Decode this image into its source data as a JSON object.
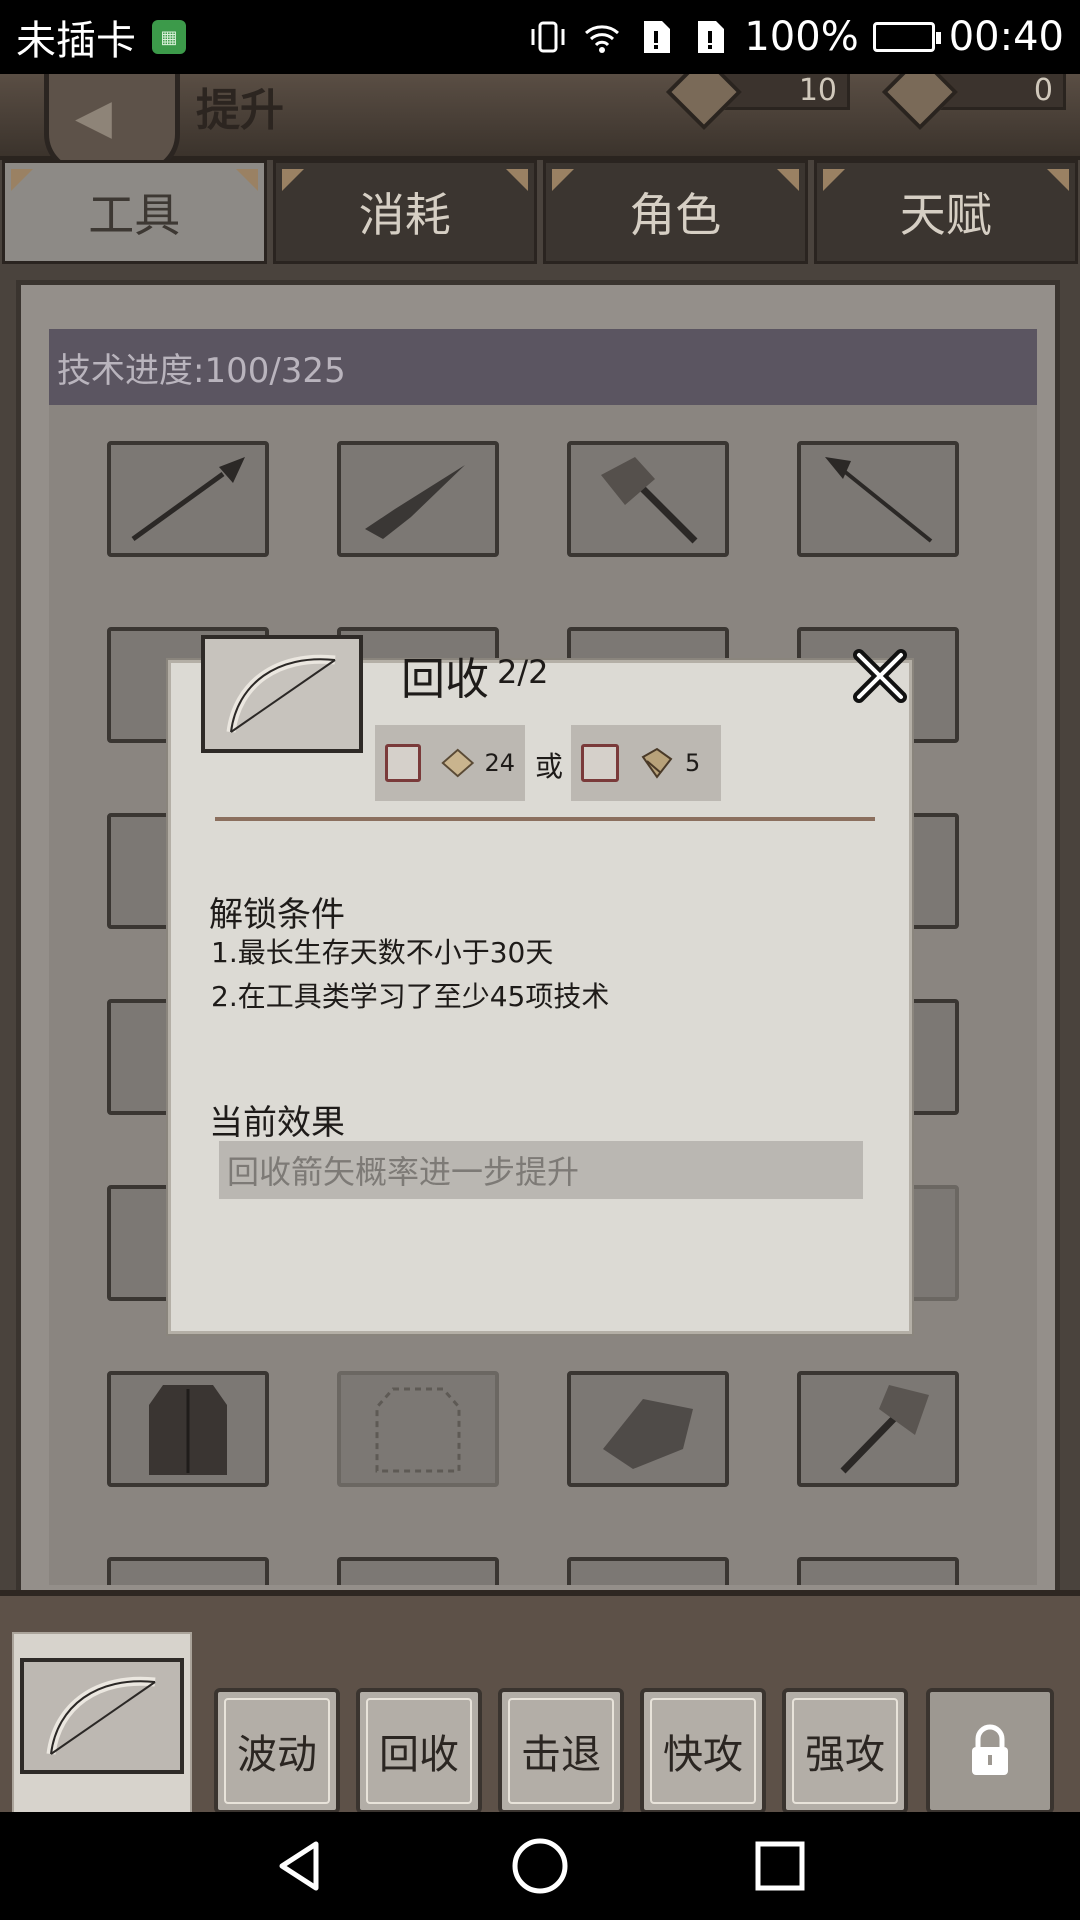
{
  "status": {
    "carrier": "未插卡",
    "battery_pct": "100%",
    "time": "00:40"
  },
  "header": {
    "title": "提升",
    "res1": "10",
    "res2": "0"
  },
  "tabs": [
    "工具",
    "消耗",
    "角色",
    "天赋"
  ],
  "active_tab": "工具",
  "progress": {
    "label": "技术进度:100/325"
  },
  "modal": {
    "title": "回收",
    "level": "2/2",
    "cost1_amount": "24",
    "or_text": "或",
    "cost2_amount": "5",
    "unlock_heading": "解锁条件",
    "conditions": [
      "1.最长生存天数不小于30天",
      "2.在工具类学习了至少45项技术"
    ],
    "effect_heading": "当前效果",
    "effect_text": "回收箭矢概率进一步提升"
  },
  "skills": [
    "波动",
    "回收",
    "击退",
    "快攻",
    "强攻"
  ],
  "colors": {
    "accent_corner": "#9a8163",
    "panel_bg": "#948f8a",
    "progress_bg": "#5b5561",
    "modal_bg": "#dcdad4"
  }
}
